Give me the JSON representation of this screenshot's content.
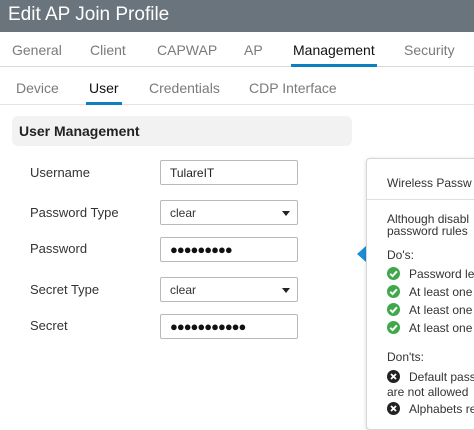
{
  "window": {
    "title": "Edit AP Join Profile"
  },
  "main_tabs": [
    {
      "label": "General",
      "active": false
    },
    {
      "label": "Client",
      "active": false
    },
    {
      "label": "CAPWAP",
      "active": false
    },
    {
      "label": "AP",
      "active": false
    },
    {
      "label": "Management",
      "active": true
    },
    {
      "label": "Security",
      "active": false
    }
  ],
  "sub_tabs": [
    {
      "label": "Device",
      "active": false
    },
    {
      "label": "User",
      "active": true
    },
    {
      "label": "Credentials",
      "active": false
    },
    {
      "label": "CDP Interface",
      "active": false
    }
  ],
  "section": {
    "title": "User Management"
  },
  "form": {
    "username": {
      "label": "Username",
      "value": "TulareIT"
    },
    "password_type": {
      "label": "Password Type",
      "value": "clear"
    },
    "password": {
      "label": "Password",
      "value": "●●●●●●●●●"
    },
    "secret_type": {
      "label": "Secret Type",
      "value": "clear"
    },
    "secret": {
      "label": "Secret",
      "value": "●●●●●●●●●●●"
    }
  },
  "tooltip": {
    "title": "Wireless Passw",
    "intro_line1": "Although disabl",
    "intro_line2": "password rules",
    "dos_heading": "Do's:",
    "dos": [
      "Password le",
      "At least one",
      "At least one",
      "At least one"
    ],
    "donts_heading": "Don'ts:",
    "donts": [
      {
        "line1": "Default passw",
        "line2": "are not allowed"
      },
      {
        "line1": "Alphabets re",
        "line2": ""
      }
    ]
  },
  "colors": {
    "accent": "#0d7fbf",
    "titlebar": "#6a747c",
    "ok": "#3ea84a",
    "error": "#222222"
  }
}
